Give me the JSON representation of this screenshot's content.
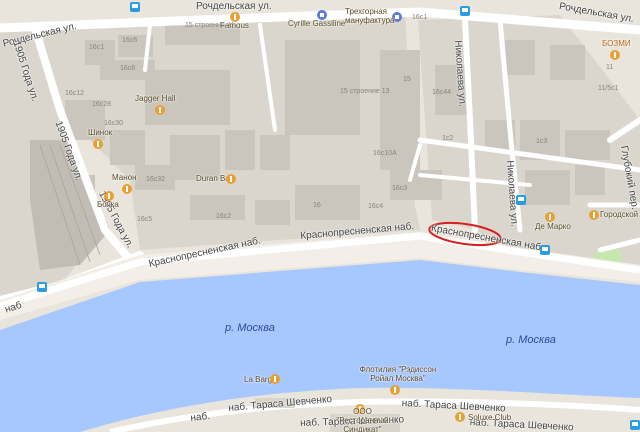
{
  "map": {
    "colors": {
      "land": "#e9e5dc",
      "block": "#d8d4cb",
      "building": "#ccc8bf",
      "road": "#ffffff",
      "embankment": "#f3efe8",
      "water": "#a7c7ff",
      "park": "#c6e7b0",
      "highlight": "#d62020",
      "poi_orange": "#e8a033",
      "poi_blue": "#5b7bd5",
      "transit": "#2a9ce0"
    },
    "streets": {
      "rochdelskaya_top": "Рочдельская ул.",
      "rochdelskaya_left": "Рочдельская ул.",
      "rochdelskaya_right": "Рочдельская ул.",
      "goda_1905_a": "1905 Года ул.",
      "goda_1905_b": "1905 Года ул.",
      "goda_1905_c": "1905 Года ул.",
      "krasnopresnenskaya_1": "Краснопресненская наб.",
      "krasnopresnenskaya_2": "Краснопресненская наб.",
      "krasnopresnenskaya_3": "Краснопресненская наб.",
      "nab_left": "наб",
      "nikolaeva": "Николаева ул.",
      "nikolaeva_2": "Николаева ул.",
      "glubokiy": "Глубокий пер.",
      "tarasa_1": "наб. Тараса Шевченко",
      "tarasa_2": "наб. Тараса Шевченко",
      "tarasa_3": "наб. Тараса Шевченко",
      "tarasa_4": "наб. Тараса Шевченко",
      "nab_bottom_left": "наб."
    },
    "water_labels": {
      "moskva_1": "р. Москва",
      "moskva_2": "р. Москва"
    },
    "poi": {
      "famous": "Famous",
      "cyrille": "Cyrille Gassiline",
      "trekhgornaya": "Трехгорная мануфактура",
      "jagger": "Jagger Hall",
      "shinok": "Шинок",
      "manon": "Манон",
      "bochka": "Бочка",
      "duran": "Duran Bar",
      "bozmi": "БОЗМИ",
      "de_marko": "Де Марко",
      "gorodskoy": "Городской ка",
      "la_barge": "La Barge",
      "flotilia": "Флотилия \"Рэдиссон Ройал Москва\"",
      "ooo": "ООО \"Ресторанный Синдикат\"",
      "soluxe": "Soluxe Club"
    },
    "building_numbers": {
      "n1": "16с1",
      "n2": "16с6",
      "n3": "15 строение 41",
      "n4": "16с1",
      "n5": "16с8",
      "n6": "16с12",
      "n7": "16с28",
      "n8": "16с30",
      "n9": "15 строение 13",
      "n10": "15",
      "n11": "16с44",
      "n12": "1с2",
      "n13": "16с10А",
      "n14": "16с3",
      "n15": "16с32",
      "n16": "16с5",
      "n17": "16с2",
      "n18": "16",
      "n19": "16с4",
      "n20": "11/5с1",
      "n21": "1с3",
      "n22": "11"
    }
  }
}
